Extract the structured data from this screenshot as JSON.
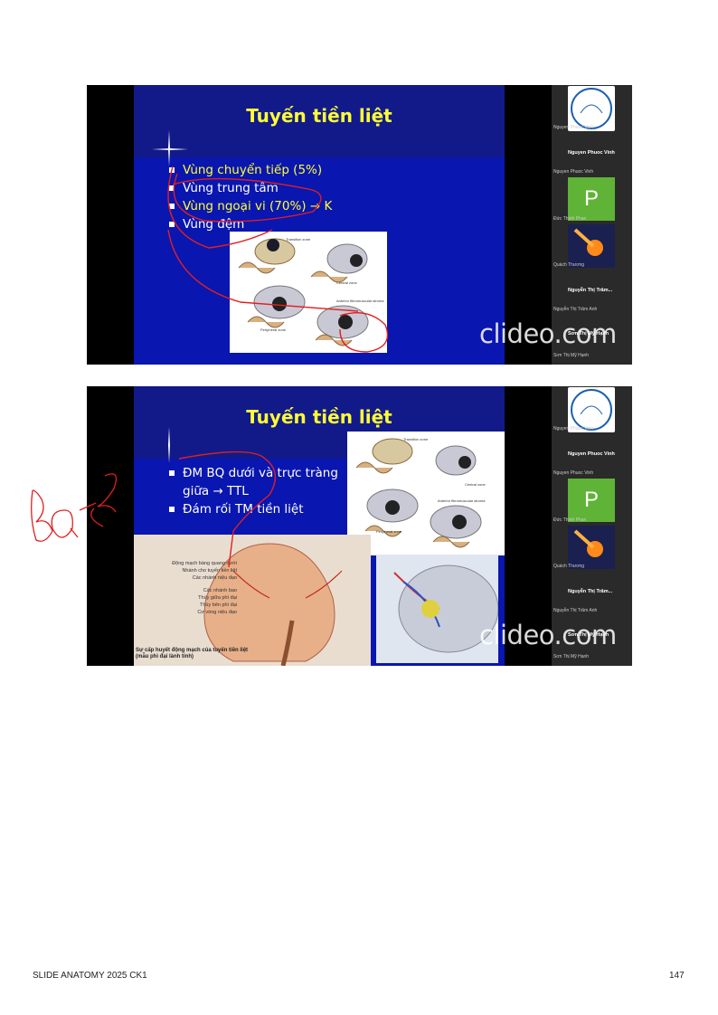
{
  "slide1": {
    "title": "Tuyến tiền liệt",
    "bullets": [
      "Vùng chuyển tiếp (5%)",
      "Vùng trung tâm",
      "Vùng ngoại vi (70%) → K",
      "Vùng đệm"
    ],
    "figure_labels": [
      "Transition zone",
      "Central zone",
      "Peripheral zone",
      "Anterior fibromuscular stroma"
    ]
  },
  "slide2": {
    "title": "Tuyến tiền liệt",
    "bullets": [
      "ĐM BQ dưới và trực tràng giữa → TTL",
      "Đám rối TM tiền liệt"
    ],
    "figure_labels": [
      "Transition zone",
      "Central zone",
      "Peripheral zone",
      "Anterior fibromuscular stroma"
    ],
    "anatomy_labels": [
      "Động mạch bàng quang dưới",
      "Nhánh cho tuyến tiền liệt",
      "Các nhánh niệu đạo",
      "Các nhánh bao",
      "Thùy giữa phì đại",
      "Thùy bên phì đại",
      "Cơ vòng niệu đạo"
    ],
    "caption": "Sự cấp huyết động mạch của tuyến tiền liệt (mẫu phì đại lành tính)"
  },
  "participants": {
    "names": [
      "Nguyen Phuoc Vinh",
      "Nguyen Phuoc Vinh",
      "Đức Thịnh Phan",
      "Quách Thương",
      "Nguyễn Thị Trâm...",
      "Nguyễn Thị Trâm Anh",
      "Sơn Thị Mỹ Hạnh",
      "Sơn Thị Mỹ Hạnh"
    ],
    "avatar_letter": "P"
  },
  "watermark": "clideo.com",
  "handwritten": "BQ - 2",
  "footer": {
    "left": "SLIDE ANATOMY 2025 CK1",
    "right": "147"
  },
  "colors": {
    "slide_bg": "#0a16b0",
    "title": "#ffff33",
    "avatar": "#5fb336",
    "annotation": "#e02020"
  }
}
